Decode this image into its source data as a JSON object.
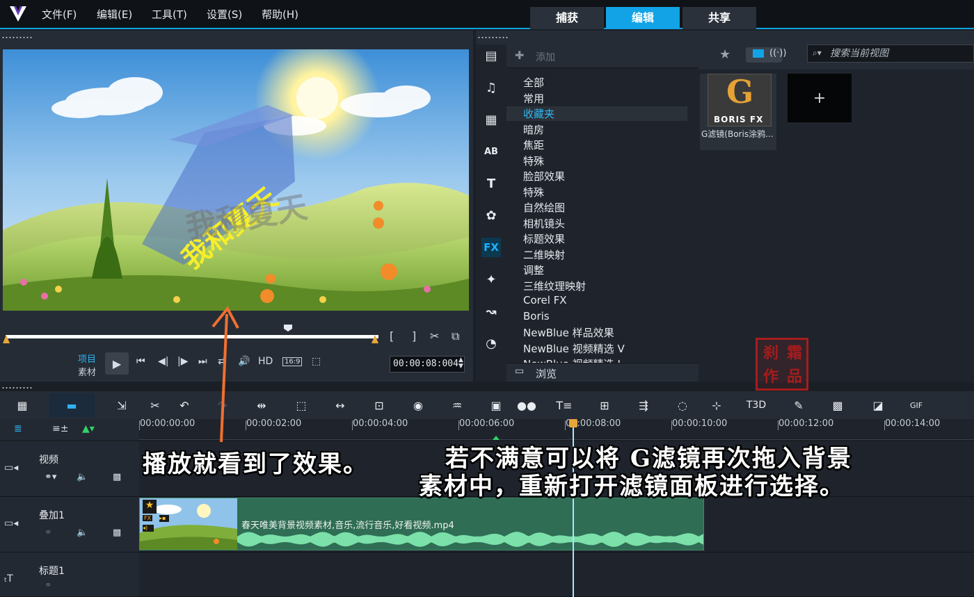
{
  "menu": [
    "文件(F)",
    "编辑(E)",
    "工具(T)",
    "设置(S)",
    "帮助(H)"
  ],
  "tabs": [
    {
      "label": "捕获",
      "active": false
    },
    {
      "label": "编辑",
      "active": true
    },
    {
      "label": "共享",
      "active": false
    }
  ],
  "preview": {
    "title_text": "我和夏天",
    "mode_project": "项目",
    "mode_clip": "素材",
    "hd_label": "HD",
    "aspect": "16:9",
    "timecode": "00:00:08:004",
    "bracket_in": "[",
    "bracket_out": "]"
  },
  "library": {
    "add_label": "添加",
    "categories": [
      "全部",
      "常用",
      "收藏夹",
      "暗房",
      "焦距",
      "特殊",
      "脸部效果",
      "特殊",
      "自然绘图",
      "相机镜头",
      "标题效果",
      "二维映射",
      "调整",
      "三维纹理映射",
      "Corel FX",
      "Boris",
      "NewBlue 样品效果",
      "NewBlue 视频精选 V",
      "NewBlue 视频精选 I"
    ],
    "selected_category": "收藏夹",
    "browse_label": "浏览",
    "search_placeholder": "搜索当前视图",
    "fx_items": [
      {
        "thumb_letter": "G",
        "thumb_brand": "BORIS FX",
        "caption": "G滤镜(Boris涂鸦..."
      }
    ],
    "add_tile_symbol": "+"
  },
  "timeline": {
    "ruler_ticks": [
      "00:00:00:00",
      "00:00:02:00",
      "00:00:04:00",
      "00:00:06:00",
      "00:00:08:00",
      "00:00:10:00",
      "00:00:12:00",
      "00:00:14:00"
    ],
    "tracks": [
      {
        "name": "视频"
      },
      {
        "name": "叠加1"
      },
      {
        "name": "标题1"
      }
    ],
    "clip_name": "春天唯美背景视频素材,音乐,流行音乐,好看视频.mp4",
    "clip_badges": [
      "FX"
    ]
  },
  "annotations": {
    "line1a": "播放就看到了效果。",
    "line1b": "若不满意可以将 G滤镜再次拖入背景",
    "line2": "素材中，重新打开滤镜面板进行选择。"
  },
  "seal": [
    "刹",
    "霜",
    "作",
    "品"
  ],
  "colors": {
    "accent": "#12a3e6",
    "clip": "#2f6d54",
    "arrow": "#f07030",
    "seal": "#a51d1d"
  }
}
